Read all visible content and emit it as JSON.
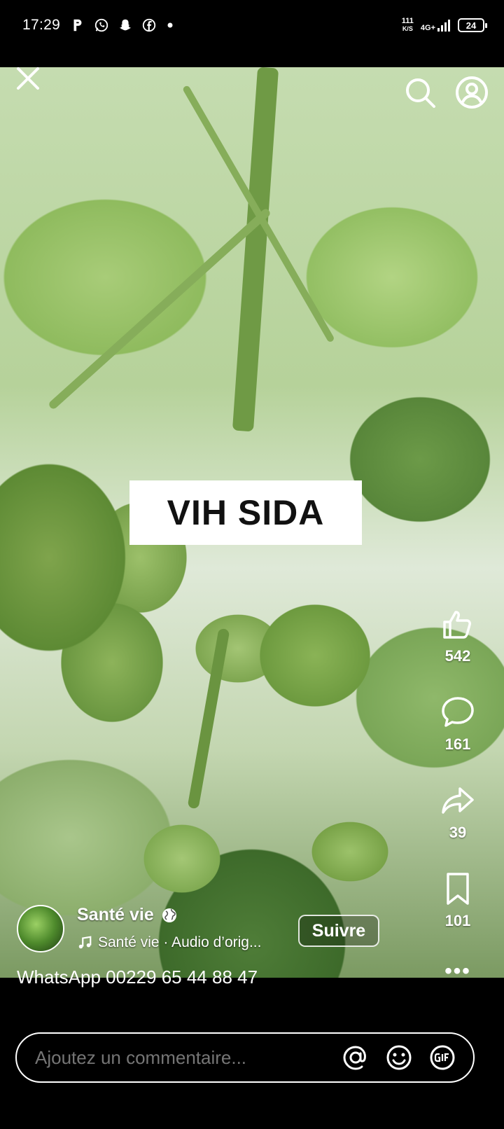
{
  "status_bar": {
    "time": "17:29",
    "speed_value": "111",
    "speed_unit": "K/S",
    "network": "4G+",
    "battery": "24",
    "notification_icons": [
      "parking-icon",
      "whatsapp-icon",
      "snapchat-icon",
      "facebook-icon",
      "dot-icon"
    ]
  },
  "video": {
    "caption_text": "VIH SIDA"
  },
  "actions": {
    "likes": "542",
    "comments": "161",
    "shares": "39",
    "saves": "101"
  },
  "author": {
    "name": "Santé vie",
    "audio": "Santé vie · Audio d’orig...",
    "follow_label": "Suivre"
  },
  "description": "WhatsApp 00229 65 44 88 47",
  "more_label": "•••",
  "comment": {
    "placeholder": "Ajoutez un commentaire..."
  },
  "colors": {
    "background": "#000000",
    "caption_bg": "#ffffff",
    "text": "#ffffff"
  }
}
